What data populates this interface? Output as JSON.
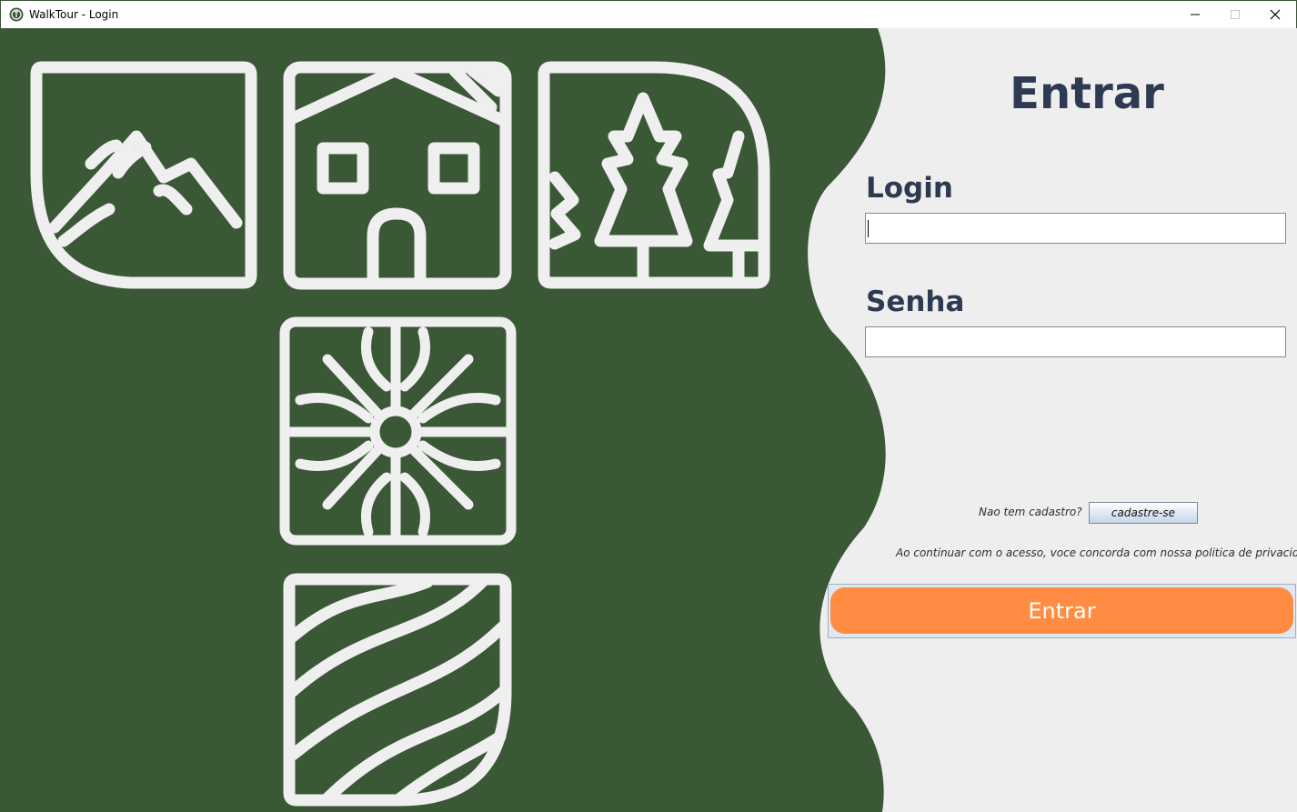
{
  "window": {
    "title": "WalkTour - Login",
    "icon": "walktour-app-icon"
  },
  "colors": {
    "panel_green": "#3a5736",
    "icon_white": "#efefef",
    "form_bg": "#eeeeee",
    "heading": "#2e3a52",
    "accent_orange": "#ff8c42"
  },
  "decor": {
    "icons": [
      "mountain-icon",
      "house-icon",
      "pine-trees-icon",
      "flower-icon",
      "waves-icon"
    ]
  },
  "form": {
    "title": "Entrar",
    "login_label": "Login",
    "login_value": "",
    "password_label": "Senha",
    "password_value": "",
    "no_account_text": "Nao tem cadastro?",
    "register_label": "cadastre-se",
    "privacy_text": "Ao continuar com o acesso, voce concorda com nossa politica de privacidade",
    "submit_label": "Entrar"
  }
}
